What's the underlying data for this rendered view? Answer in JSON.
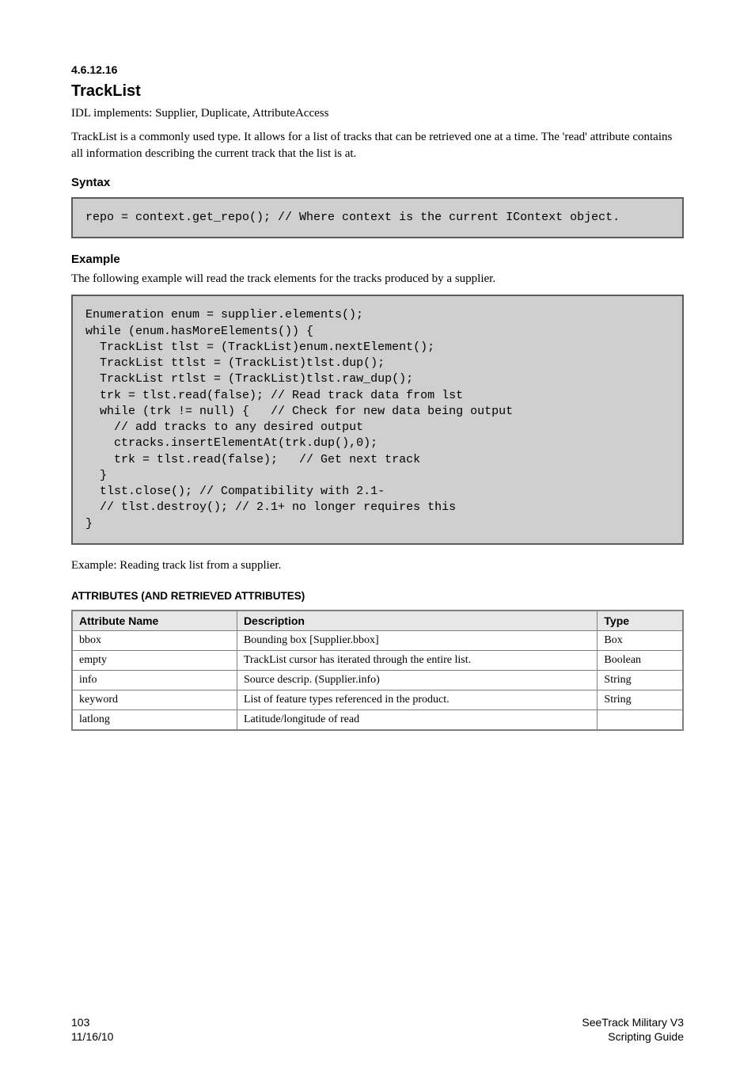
{
  "section": {
    "number": "4.6.12.16",
    "title": "TrackList",
    "interfaces": "IDL implements: Supplier, Duplicate, AttributeAccess",
    "intro": "TrackList is a commonly used type. It allows for a list of tracks that can be retrieved one at a time. The 'read' attribute contains all information describing the current track that the list is at."
  },
  "syntax": {
    "heading": "Syntax",
    "code": "repo = context.get_repo(); // Where context is the current IContext object."
  },
  "example": {
    "heading": "Example",
    "intro": "The following example will read the track elements for the tracks produced by a supplier.",
    "code": "Enumeration enum = supplier.elements();\nwhile (enum.hasMoreElements()) {\n  TrackList tlst = (TrackList)enum.nextElement();\n  TrackList ttlst = (TrackList)tlst.dup();\n  TrackList rtlst = (TrackList)tlst.raw_dup();\n  trk = tlst.read(false); // Read track data from lst\n  while (trk != null) {   // Check for new data being output\n    // add tracks to any desired output\n    ctracks.insertElementAt(trk.dup(),0);\n    trk = tlst.read(false);   // Get next track\n  }\n  tlst.close(); // Compatibility with 2.1-\n  // tlst.destroy(); // 2.1+ no longer requires this\n}",
    "caption": "Example: Reading track list from a supplier."
  },
  "attributes": {
    "heading": "ATTRIBUTES (AND RETRIEVED ATTRIBUTES)",
    "columns": [
      "Attribute Name",
      "Description",
      "Type"
    ],
    "rows": [
      {
        "name": "bbox",
        "desc": "Bounding box  [Supplier.bbox]",
        "type": "Box"
      },
      {
        "name": "empty",
        "desc": "TrackList cursor has iterated through the entire list.",
        "type": "Boolean"
      },
      {
        "name": "info",
        "desc": "Source descrip. (Supplier.info)",
        "type": "String"
      },
      {
        "name": "keyword",
        "desc": "List of feature types referenced in the product.",
        "type": "String"
      },
      {
        "name": "latlong",
        "desc": "Latitude/longitude of read",
        "type": ""
      }
    ]
  },
  "footer": {
    "page": "103",
    "date": "11/16/10",
    "product": "SeeTrack Military V3",
    "doc": "Scripting Guide"
  }
}
